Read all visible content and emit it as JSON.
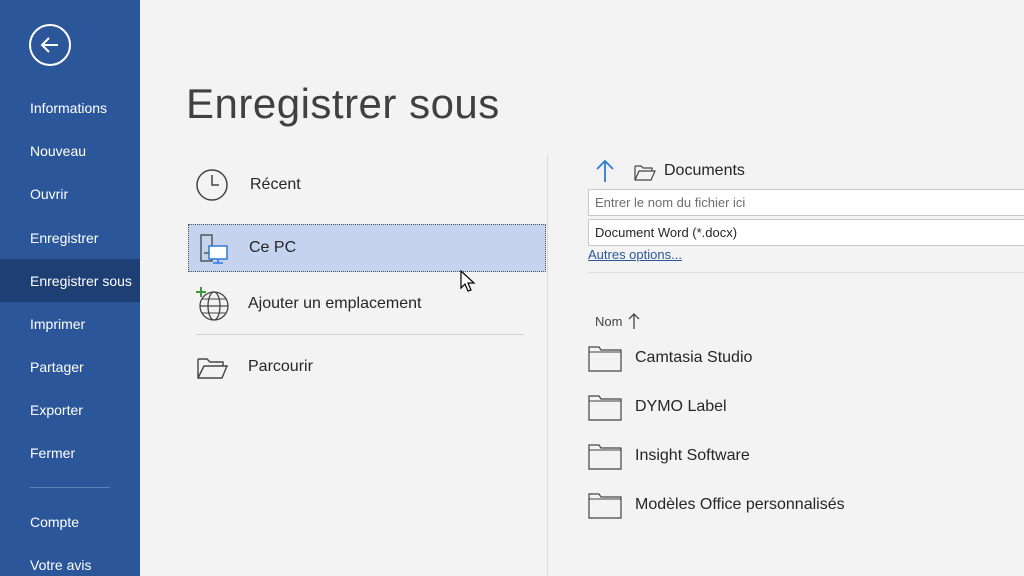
{
  "sidebar": {
    "back_icon": "back-arrow-icon",
    "items": [
      {
        "label": "Informations"
      },
      {
        "label": "Nouveau"
      },
      {
        "label": "Ouvrir"
      },
      {
        "label": "Enregistrer"
      },
      {
        "label": "Enregistrer sous",
        "active": true
      },
      {
        "label": "Imprimer"
      },
      {
        "label": "Partager"
      },
      {
        "label": "Exporter"
      },
      {
        "label": "Fermer"
      },
      {
        "label": "Compte"
      },
      {
        "label": "Votre avis"
      }
    ]
  },
  "page": {
    "title": "Enregistrer sous"
  },
  "locations": [
    {
      "label": "Récent",
      "icon": "clock-icon"
    },
    {
      "label": "Ce PC",
      "icon": "computer-icon",
      "selected": true
    },
    {
      "label": "Ajouter un emplacement",
      "icon": "globe-add-icon"
    },
    {
      "label": "Parcourir",
      "icon": "folder-open-icon"
    }
  ],
  "save_panel": {
    "current_folder": "Documents",
    "filename_placeholder": "Entrer le nom du fichier ici",
    "filetype": "Document Word (*.docx)",
    "more_options": "Autres options..."
  },
  "file_list": {
    "column_header": "Nom",
    "sort": "ascending",
    "items": [
      {
        "name": "Camtasia Studio",
        "type": "folder"
      },
      {
        "name": "DYMO Label",
        "type": "folder"
      },
      {
        "name": "Insight Software",
        "type": "folder"
      },
      {
        "name": "Modèles Office personnalisés",
        "type": "folder"
      }
    ]
  },
  "colors": {
    "sidebar": "#2b579a",
    "sidebar_active": "#1e3f73",
    "selected_location": "#c5d3ef",
    "link": "#2b579a"
  }
}
